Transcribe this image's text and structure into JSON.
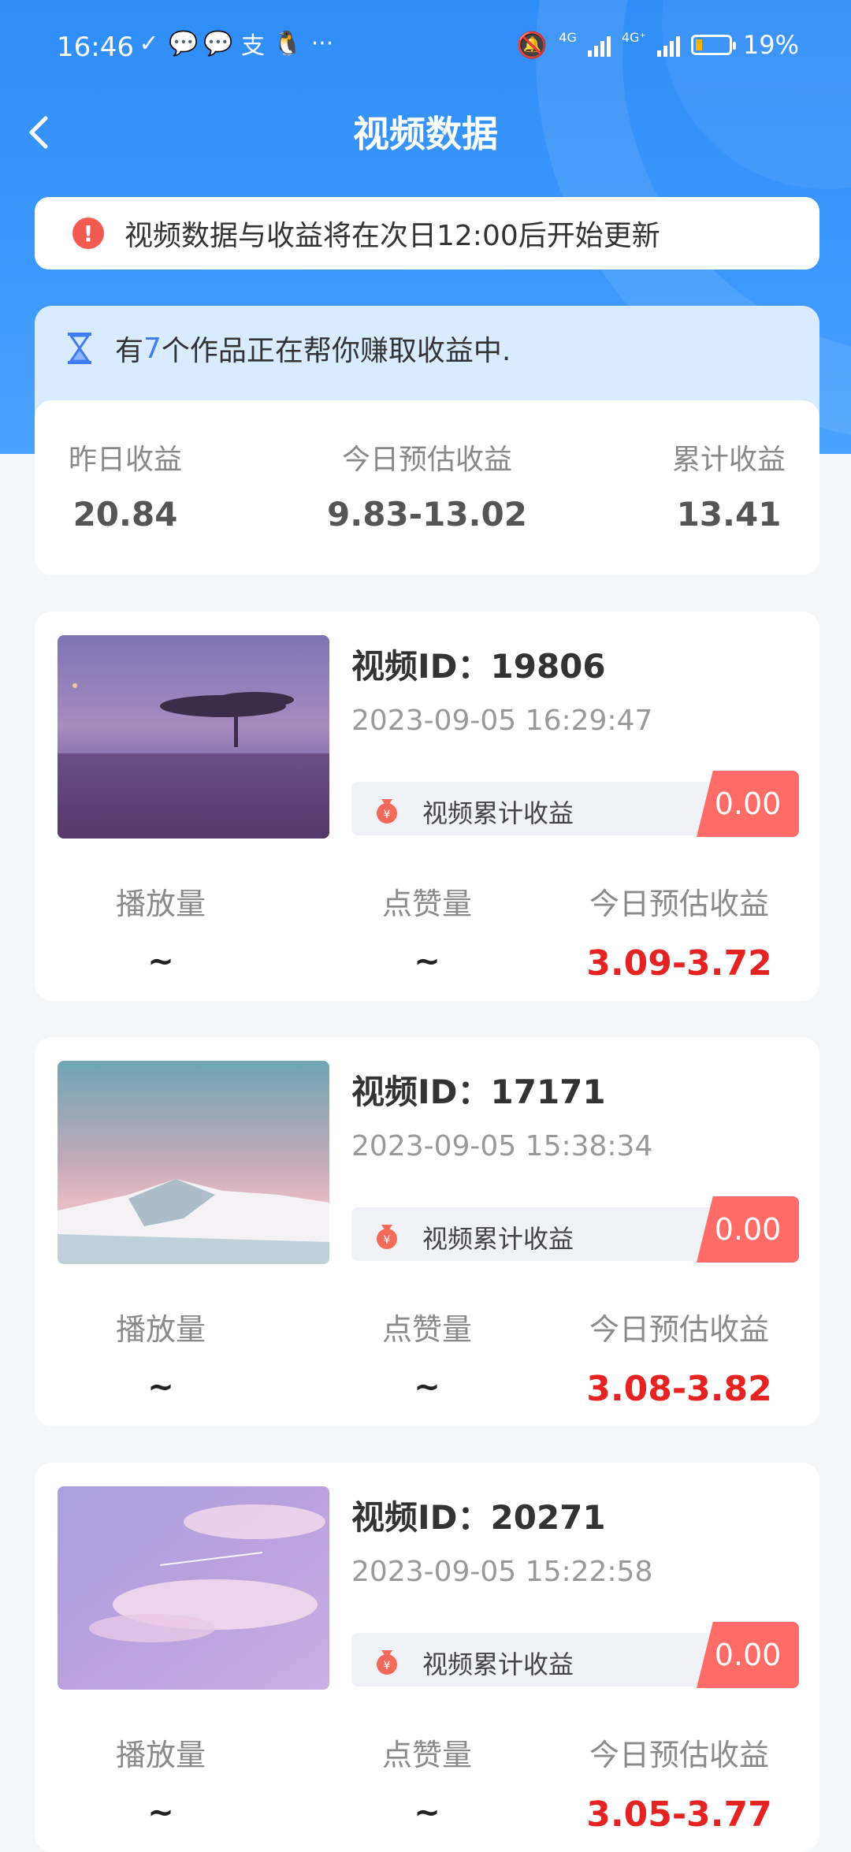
{
  "status_bar": {
    "time": "16:46",
    "more": "···",
    "net1": "4G",
    "net2": "4G⁺",
    "battery": "19%"
  },
  "header": {
    "title": "视频数据"
  },
  "notice": {
    "text": "视频数据与收益将在次日12:00后开始更新"
  },
  "earning_banner": {
    "prefix": "有",
    "count": "7",
    "suffix": "个作品正在帮你赚取收益中."
  },
  "summary": [
    {
      "label": "昨日收益",
      "value": "20.84"
    },
    {
      "label": "今日预估收益",
      "value": "9.83-13.02"
    },
    {
      "label": "累计收益",
      "value": "13.41"
    }
  ],
  "videos": [
    {
      "title": "视频ID：19806",
      "date": "2023-09-05 16:29:47",
      "cum_label": "视频累计收益",
      "cum_value": "0.00",
      "plays_label": "播放量",
      "plays": "~",
      "likes_label": "点赞量",
      "likes": "~",
      "est_label": "今日预估收益",
      "est": "3.09-3.72"
    },
    {
      "title": "视频ID：17171",
      "date": "2023-09-05 15:38:34",
      "cum_label": "视频累计收益",
      "cum_value": "0.00",
      "plays_label": "播放量",
      "plays": "~",
      "likes_label": "点赞量",
      "likes": "~",
      "est_label": "今日预估收益",
      "est": "3.08-3.82"
    },
    {
      "title": "视频ID：20271",
      "date": "2023-09-05 15:22:58",
      "cum_label": "视频累计收益",
      "cum_value": "0.00",
      "plays_label": "播放量",
      "plays": "~",
      "likes_label": "点赞量",
      "likes": "~",
      "est_label": "今日预估收益",
      "est": "3.05-3.77"
    }
  ],
  "colors": {
    "primary": "#3a97fb",
    "accent_red": "#e62323",
    "badge": "#ff6b66",
    "highlight": "#3f7df5"
  }
}
